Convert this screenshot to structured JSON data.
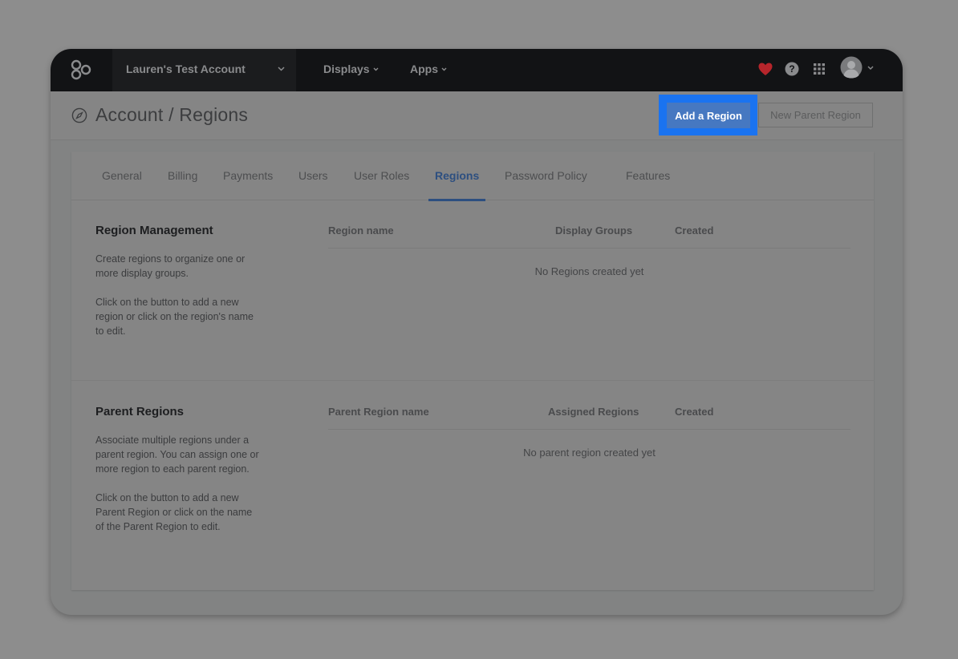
{
  "topnav": {
    "account_name": "Lauren's Test Account",
    "links": [
      {
        "label": "Displays"
      },
      {
        "label": "Apps"
      }
    ],
    "icons": [
      "logo-icon",
      "heart-icon",
      "help-icon",
      "apps-grid-icon",
      "avatar",
      "chevron-down-icon"
    ],
    "heart_color": "#b6252b"
  },
  "header": {
    "title": "Account / Regions",
    "add_region_label": "Add a Region",
    "new_parent_region_label": "New Parent Region",
    "highlight_color": "#1a73f0"
  },
  "tabs": [
    {
      "label": "General"
    },
    {
      "label": "Billing"
    },
    {
      "label": "Payments"
    },
    {
      "label": "Users"
    },
    {
      "label": "User Roles"
    },
    {
      "label": "Regions",
      "active": true
    },
    {
      "label": "Password Policy"
    },
    {
      "label": "Features"
    }
  ],
  "region_management": {
    "title": "Region Management",
    "desc_1": "Create regions to organize one or more display groups.",
    "desc_2": "Click on the button to add a new region or click on the region's name to edit.",
    "columns": [
      "Region name",
      "Display Groups",
      "Created"
    ],
    "empty": "No Regions created yet"
  },
  "parent_regions": {
    "title": "Parent Regions",
    "desc_1": "Associate multiple regions under a parent region. You can assign one or more region to each parent region.",
    "desc_2": "Click on the button to add a new Parent Region or click on the name of the Parent Region to edit.",
    "columns": [
      "Parent Region name",
      "Assigned Regions",
      "Created"
    ],
    "empty": "No parent region created yet"
  }
}
